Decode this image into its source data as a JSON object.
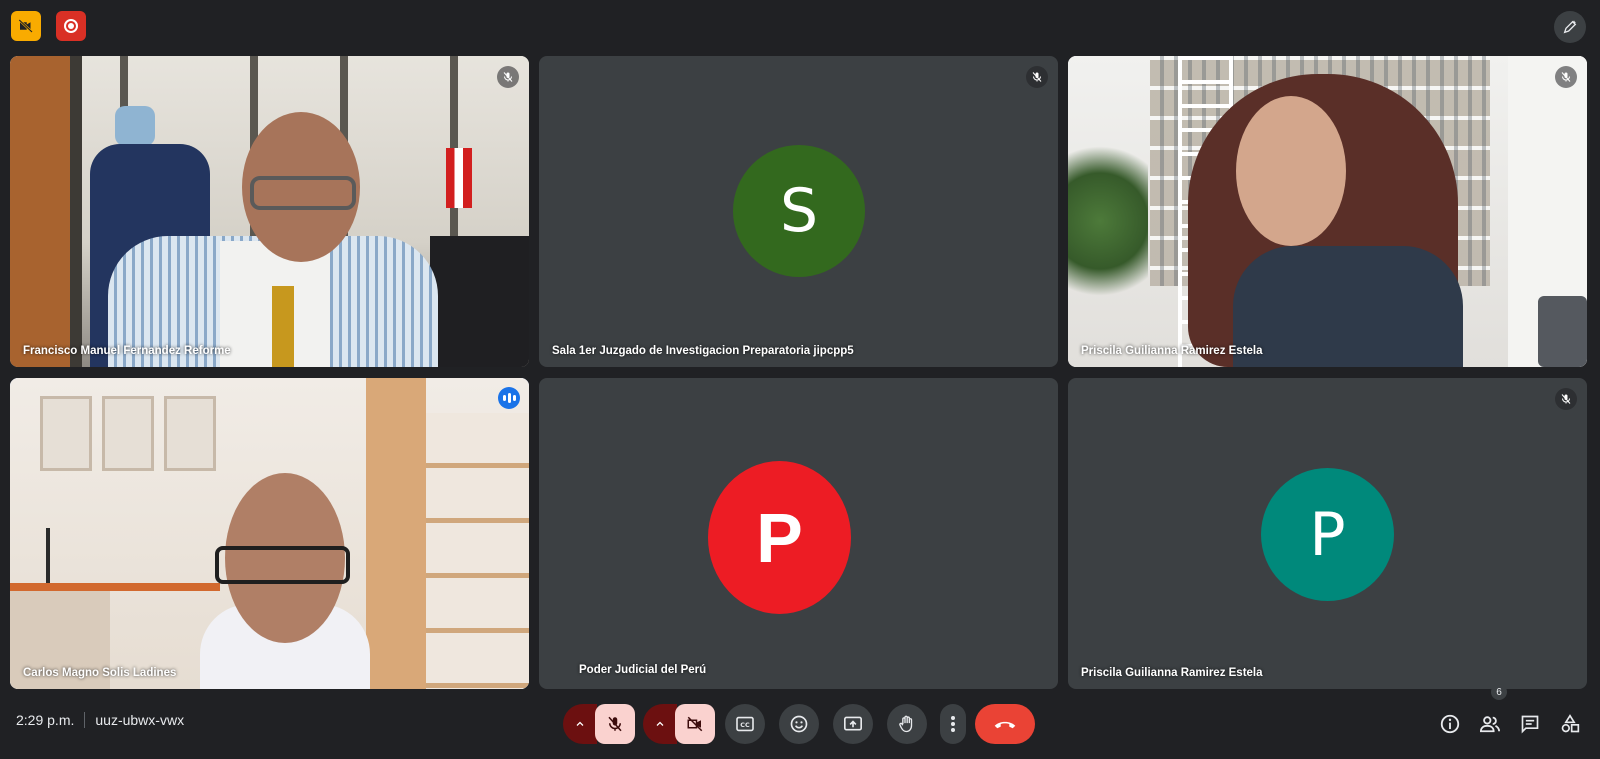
{
  "meeting": {
    "time": "2:29 p.m.",
    "code": "uuz-ubwx-vwx",
    "participant_count": "6"
  },
  "tiles": [
    {
      "name": "Francisco Manuel Fernandez Reforme"
    },
    {
      "name": "Sala 1er Juzgado de Investigacion Preparatoria jipcpp5",
      "initial": "S"
    },
    {
      "name": "Priscila Guilianna Ramirez Estela"
    },
    {
      "name": "Carlos Magno Solis Ladines"
    },
    {
      "name": "Poder Judicial del Perú",
      "initial": "P"
    },
    {
      "name": "Priscila Guilianna Ramirez Estela",
      "initial": "P"
    }
  ],
  "colors": {
    "background": "#202124",
    "tile": "#3c4043",
    "avatar_s": "#33691e",
    "avatar_p_red": "#ed1c24",
    "avatar_p_teal": "#00897b",
    "end_call": "#ea4335",
    "speaking_outline": "#8ab4f8"
  }
}
